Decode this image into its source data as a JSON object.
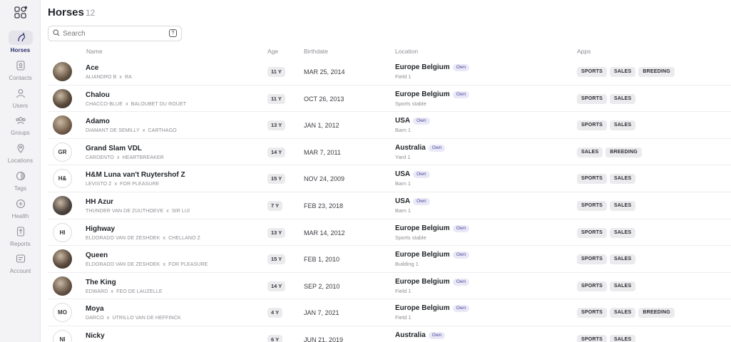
{
  "sidebar": {
    "items": [
      {
        "label": "Horses",
        "icon": "horse-head-icon",
        "active": true
      },
      {
        "label": "Contacts",
        "icon": "contact-card-icon",
        "active": false
      },
      {
        "label": "Users",
        "icon": "user-icon",
        "active": false
      },
      {
        "label": "Groups",
        "icon": "group-icon",
        "active": false
      },
      {
        "label": "Locations",
        "icon": "location-pin-icon",
        "active": false
      },
      {
        "label": "Tags",
        "icon": "tag-icon",
        "active": false
      },
      {
        "label": "Health",
        "icon": "health-icon",
        "active": false
      },
      {
        "label": "Reports",
        "icon": "report-icon",
        "active": false
      },
      {
        "label": "Account",
        "icon": "account-icon",
        "active": false
      }
    ]
  },
  "header": {
    "title": "Horses",
    "count": "12"
  },
  "search": {
    "placeholder": "Search",
    "help_key": "?"
  },
  "table": {
    "columns": {
      "name": "Name",
      "age": "Age",
      "birthdate": "Birthdate",
      "location": "Location",
      "apps": "Apps"
    },
    "rows": [
      {
        "name": "Ace",
        "sire": "ALIANDRO B",
        "sep": "x",
        "dam": "RA",
        "age": "11 Y",
        "birthdate": "MAR 25, 2014",
        "location": "Europe Belgium",
        "sublocation": "Field 1",
        "own": "Own",
        "apps": [
          "SPORTS",
          "SALES",
          "BREEDING"
        ],
        "avatar": "",
        "avatar_color": "#6b5a48"
      },
      {
        "name": "Chalou",
        "sire": "CHACCO-BLUE",
        "sep": "x",
        "dam": "BALOUBET DU ROUET",
        "age": "11 Y",
        "birthdate": "OCT 26, 2013",
        "location": "Europe Belgium",
        "sublocation": "Sports stable",
        "own": "Own",
        "apps": [
          "SPORTS",
          "SALES"
        ],
        "avatar": "",
        "avatar_color": "#5a4a3a"
      },
      {
        "name": "Adamo",
        "sire": "DIAMANT DE SEMILLY",
        "sep": "x",
        "dam": "CARTHAGO",
        "age": "13 Y",
        "birthdate": "JAN 1, 2012",
        "location": "USA",
        "sublocation": "Barn 1",
        "own": "Own",
        "apps": [
          "SPORTS",
          "SALES"
        ],
        "avatar": "",
        "avatar_color": "#7a6450"
      },
      {
        "name": "Grand Slam VDL",
        "sire": "CARDENTO",
        "sep": "x",
        "dam": "HEARTBREAKER",
        "age": "14 Y",
        "birthdate": "MAR 7, 2011",
        "location": "Australia",
        "sublocation": "Yard 1",
        "own": "Own",
        "apps": [
          "SALES",
          "BREEDING"
        ],
        "avatar": "GR",
        "avatar_color": ""
      },
      {
        "name": "H&M Luna van't Ruytershof Z",
        "sire": "LEVISTO Z",
        "sep": "x",
        "dam": "FOR PLEASURE",
        "age": "15 Y",
        "birthdate": "NOV 24, 2009",
        "location": "USA",
        "sublocation": "Barn 1",
        "own": "Own",
        "apps": [
          "SPORTS",
          "SALES"
        ],
        "avatar": "H&",
        "avatar_color": ""
      },
      {
        "name": "HH Azur",
        "sire": "THUNDER VAN DE ZUUTHOEVE",
        "sep": "x",
        "dam": "SIR LUI",
        "age": "7 Y",
        "birthdate": "FEB 23, 2018",
        "location": "USA",
        "sublocation": "Barn 1",
        "own": "Own",
        "apps": [
          "SPORTS",
          "SALES"
        ],
        "avatar": "",
        "avatar_color": "#4e4540"
      },
      {
        "name": "Highway",
        "sire": "ELDORADO VAN DE ZESHOEK",
        "sep": "x",
        "dam": "CHELLANO Z",
        "age": "13 Y",
        "birthdate": "MAR 14, 2012",
        "location": "Europe Belgium",
        "sublocation": "Sports stable",
        "own": "Own",
        "apps": [
          "SPORTS",
          "SALES"
        ],
        "avatar": "HI",
        "avatar_color": ""
      },
      {
        "name": "Queen",
        "sire": "ELDORADO VAN DE ZESHOEK",
        "sep": "x",
        "dam": "FOR PLEASURE",
        "age": "15 Y",
        "birthdate": "FEB 1, 2010",
        "location": "Europe Belgium",
        "sublocation": "Building 1",
        "own": "Own",
        "apps": [
          "SPORTS",
          "SALES"
        ],
        "avatar": "",
        "avatar_color": "#5c4b3d"
      },
      {
        "name": "The King",
        "sire": "EDWARD",
        "sep": "x",
        "dam": "FEO DE LAUZELLE",
        "age": "14 Y",
        "birthdate": "SEP 2, 2010",
        "location": "Europe Belgium",
        "sublocation": "Field 1",
        "own": "Own",
        "apps": [
          "SPORTS",
          "SALES"
        ],
        "avatar": "",
        "avatar_color": "#6a5848"
      },
      {
        "name": "Moya",
        "sire": "DARCO",
        "sep": "x",
        "dam": "UTRILLO VAN DE HEFFINCK",
        "age": "4 Y",
        "birthdate": "JAN 7, 2021",
        "location": "Europe Belgium",
        "sublocation": "Field 1",
        "own": "Own",
        "apps": [
          "SPORTS",
          "SALES",
          "BREEDING"
        ],
        "avatar": "MO",
        "avatar_color": ""
      },
      {
        "name": "Nicky",
        "sire": "",
        "sep": "",
        "dam": "",
        "age": "6 Y",
        "birthdate": "JUN 21, 2019",
        "location": "Australia",
        "sublocation": "",
        "own": "Own",
        "apps": [
          "SPORTS",
          "SALES"
        ],
        "avatar": "NI",
        "avatar_color": ""
      }
    ]
  },
  "colors": {
    "accent": "#2b2d6e",
    "own_badge_bg": "#e9e8f7",
    "own_badge_text": "#4b4a9a",
    "sidebar_bg": "#f3f3f5"
  }
}
